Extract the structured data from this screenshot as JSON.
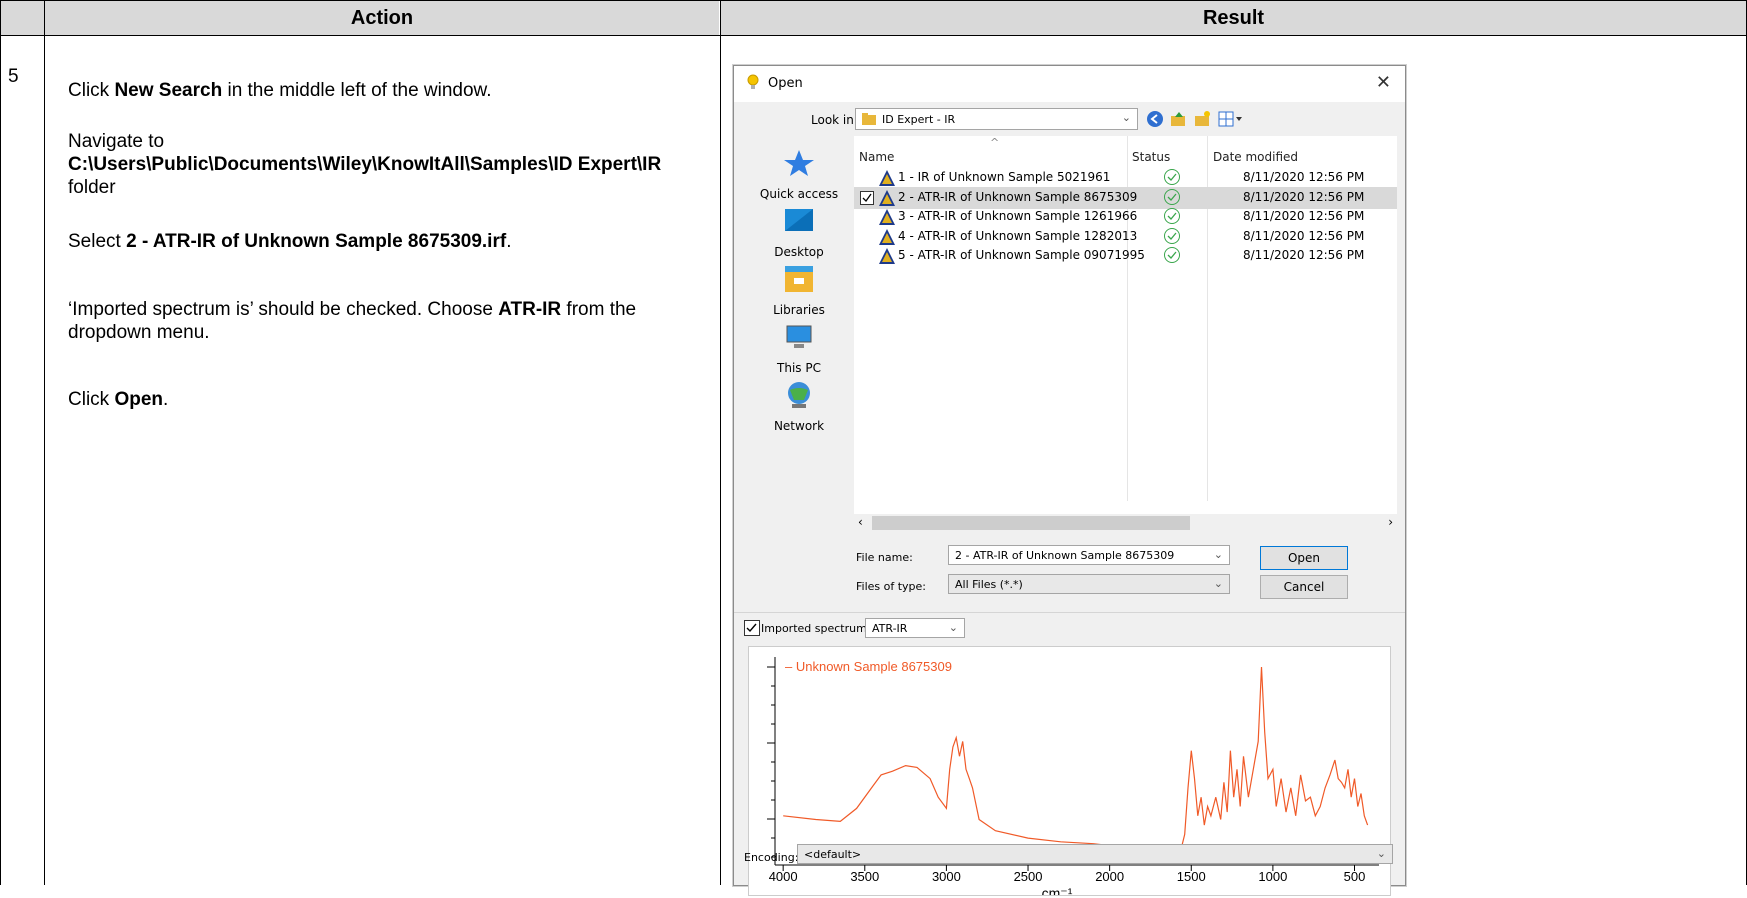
{
  "table": {
    "headers": {
      "action": "Action",
      "result": "Result"
    },
    "step_number": "5",
    "action_lines": [
      {
        "pre": "Click ",
        "bold": "New Search",
        "post": " in the middle left of the window."
      },
      {
        "pre": "Navigate to ",
        "bold": "C:\\Users\\Public\\Documents\\Wiley\\KnowItAll\\Samples\\ID Expert\\IR",
        "post": " folder"
      },
      {
        "pre": "Select ",
        "bold": "2 - ATR-IR of Unknown Sample 8675309.irf",
        "post": "."
      },
      {
        "pre": "‘Imported spectrum is’ should be checked.  Choose ",
        "bold": "ATR-IR",
        "post": " from the dropdown menu."
      },
      {
        "pre": "Click ",
        "bold": "Open",
        "post": "."
      }
    ]
  },
  "dialog": {
    "title": "Open",
    "close_glyph": "✕",
    "look_in_label": "Look in:",
    "look_in_value": "ID Expert - IR",
    "places": [
      "Quick access",
      "Desktop",
      "Libraries",
      "This PC",
      "Network"
    ],
    "columns": {
      "name": "Name",
      "status": "Status",
      "date": "Date modified"
    },
    "files": [
      {
        "name": "1 - IR of Unknown Sample 5021961",
        "date": "8/11/2020 12:56 PM",
        "selected": false
      },
      {
        "name": "2 - ATR-IR of Unknown Sample 8675309",
        "date": "8/11/2020 12:56 PM",
        "selected": true
      },
      {
        "name": "3 - ATR-IR of Unknown Sample 1261966",
        "date": "8/11/2020 12:56 PM",
        "selected": false
      },
      {
        "name": "4 - ATR-IR of Unknown Sample 1282013",
        "date": "8/11/2020 12:56 PM",
        "selected": false
      },
      {
        "name": "5 - ATR-IR of Unknown Sample 09071995",
        "date": "8/11/2020 12:56 PM",
        "selected": false
      }
    ],
    "file_name_label": "File name:",
    "file_name_value": "2 - ATR-IR of Unknown Sample 8675309",
    "files_of_type_label": "Files of type:",
    "files_of_type_value": "All Files (*.*)",
    "open_button": "Open",
    "cancel_button": "Cancel",
    "imported_label": "Imported spectrum is",
    "imported_value": "ATR-IR",
    "encoding_label": "Encoding:",
    "encoding_value": "<default>"
  },
  "chart_data": {
    "type": "line",
    "legend": "Unknown Sample 8675309",
    "xlabel": "cm⁻¹",
    "xticks": [
      4000,
      3500,
      3000,
      2500,
      2000,
      1500,
      1000,
      500
    ],
    "xlim": [
      4050,
      350
    ],
    "ylim": [
      0,
      1
    ],
    "color": "#f05a28",
    "series": [
      {
        "name": "Unknown Sample 8675309",
        "points": [
          [
            4000,
            0.2
          ],
          [
            3800,
            0.18
          ],
          [
            3650,
            0.17
          ],
          [
            3550,
            0.24
          ],
          [
            3450,
            0.36
          ],
          [
            3400,
            0.42
          ],
          [
            3330,
            0.44
          ],
          [
            3250,
            0.47
          ],
          [
            3180,
            0.46
          ],
          [
            3100,
            0.4
          ],
          [
            3050,
            0.3
          ],
          [
            3000,
            0.24
          ],
          [
            2980,
            0.45
          ],
          [
            2960,
            0.57
          ],
          [
            2940,
            0.62
          ],
          [
            2920,
            0.52
          ],
          [
            2900,
            0.6
          ],
          [
            2880,
            0.45
          ],
          [
            2860,
            0.4
          ],
          [
            2840,
            0.35
          ],
          [
            2800,
            0.18
          ],
          [
            2700,
            0.12
          ],
          [
            2500,
            0.08
          ],
          [
            2300,
            0.06
          ],
          [
            2100,
            0.05
          ],
          [
            2000,
            0.04
          ],
          [
            1900,
            0.03
          ],
          [
            1800,
            0.03
          ],
          [
            1700,
            0.03
          ],
          [
            1650,
            0.02
          ],
          [
            1600,
            0.02
          ],
          [
            1560,
            0.03
          ],
          [
            1540,
            0.1
          ],
          [
            1520,
            0.35
          ],
          [
            1500,
            0.55
          ],
          [
            1480,
            0.4
          ],
          [
            1460,
            0.2
          ],
          [
            1440,
            0.3
          ],
          [
            1420,
            0.15
          ],
          [
            1400,
            0.25
          ],
          [
            1380,
            0.2
          ],
          [
            1350,
            0.3
          ],
          [
            1320,
            0.18
          ],
          [
            1300,
            0.38
          ],
          [
            1280,
            0.22
          ],
          [
            1260,
            0.55
          ],
          [
            1240,
            0.3
          ],
          [
            1220,
            0.45
          ],
          [
            1200,
            0.25
          ],
          [
            1180,
            0.52
          ],
          [
            1150,
            0.3
          ],
          [
            1120,
            0.45
          ],
          [
            1090,
            0.6
          ],
          [
            1070,
            1.0
          ],
          [
            1050,
            0.65
          ],
          [
            1030,
            0.4
          ],
          [
            1000,
            0.45
          ],
          [
            980,
            0.25
          ],
          [
            950,
            0.4
          ],
          [
            920,
            0.22
          ],
          [
            890,
            0.35
          ],
          [
            860,
            0.2
          ],
          [
            830,
            0.42
          ],
          [
            800,
            0.28
          ],
          [
            770,
            0.3
          ],
          [
            740,
            0.2
          ],
          [
            710,
            0.25
          ],
          [
            680,
            0.35
          ],
          [
            650,
            0.42
          ],
          [
            620,
            0.5
          ],
          [
            600,
            0.4
          ],
          [
            580,
            0.38
          ],
          [
            560,
            0.35
          ],
          [
            540,
            0.45
          ],
          [
            520,
            0.3
          ],
          [
            500,
            0.4
          ],
          [
            480,
            0.25
          ],
          [
            460,
            0.32
          ],
          [
            440,
            0.2
          ],
          [
            420,
            0.15
          ]
        ]
      }
    ]
  }
}
